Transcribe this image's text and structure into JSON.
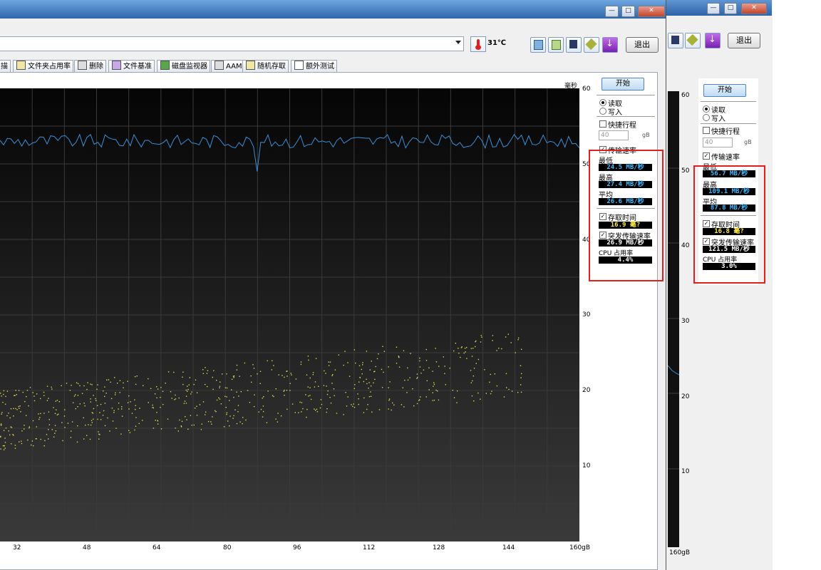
{
  "toolbar": {
    "temperature": "31℃",
    "exit_label": "退出",
    "exit_label_back": "退出"
  },
  "tabs": [
    {
      "label": "描"
    },
    {
      "label": "文件夹占用率"
    },
    {
      "label": "删除"
    },
    {
      "label": "文件基准"
    },
    {
      "label": "磁盘监视器"
    },
    {
      "label": "AAM"
    },
    {
      "label": "随机存取"
    },
    {
      "label": "额外测试"
    }
  ],
  "window_buttons": {
    "minimize": "—",
    "maximize": "□",
    "close": "✕"
  },
  "front_panel": {
    "start_label": "开始",
    "read_label": "读取",
    "write_label": "写入",
    "short_stroke_label": "快捷行程",
    "short_stroke_value": "40",
    "gb_unit": "gB",
    "transfer_rate_label": "传输速率",
    "min_label": "最低",
    "min_value": "24.5 MB/秒",
    "max_label": "最高",
    "max_value": "27.4 MB/秒",
    "avg_label": "平均",
    "avg_value": "26.6 MB/秒",
    "access_time_label": "存取时间",
    "access_time_value": "16.9 毫?",
    "burst_label": "突发传输速率",
    "burst_value": "26.9 MB/秒",
    "cpu_label": "CPU 占用率",
    "cpu_value": "4.4%"
  },
  "back_panel": {
    "start_label": "开始",
    "read_label": "读取",
    "write_label": "写入",
    "short_stroke_label": "快捷行程",
    "short_stroke_value": "40",
    "gb_unit": "gB",
    "transfer_rate_label": "传输速率",
    "min_label": "最低",
    "min_value": "56.7 MB/秒",
    "max_label": "最高",
    "max_value": "109.1 MB/秒",
    "avg_label": "平均",
    "avg_value": "87.8 MB/秒",
    "access_time_label": "存取时间",
    "access_time_value": "16.8 毫?",
    "burst_label": "突发传输速率",
    "burst_value": "121.5 MB/秒",
    "cpu_label": "CPU 占用率",
    "cpu_value": "3.0%"
  },
  "back_chart": {
    "y_ticks": [
      "60",
      "50",
      "40",
      "30",
      "20",
      "10"
    ],
    "x_end_label": "160gB"
  },
  "chart_data": {
    "type": "line",
    "ylabel": "毫秒",
    "y_ticks": [
      "60",
      "50",
      "40",
      "30",
      "20",
      "10"
    ],
    "ylim": [
      0,
      60
    ],
    "x_ticks": [
      "32",
      "48",
      "64",
      "80",
      "96",
      "112",
      "128",
      "144",
      "160gB"
    ],
    "xlim": [
      16,
      160
    ],
    "grid": true,
    "series": [
      {
        "kind": "transfer-rate",
        "color": "#3b8fd6",
        "approx_y": 53,
        "dip_x": 80,
        "dip_y": 49
      },
      {
        "kind": "access-time-scatter",
        "color": "#d6d648",
        "y_range_start": [
          12,
          20
        ],
        "y_range_end": [
          20,
          29
        ]
      }
    ]
  },
  "colors": {
    "chart_bg": "#111111",
    "grid": "#3a3a3a",
    "rate_line": "#3b8fd6",
    "scatter": "#d6d648",
    "highlight": "#e02020",
    "title_bar": "#3f7bc1"
  }
}
